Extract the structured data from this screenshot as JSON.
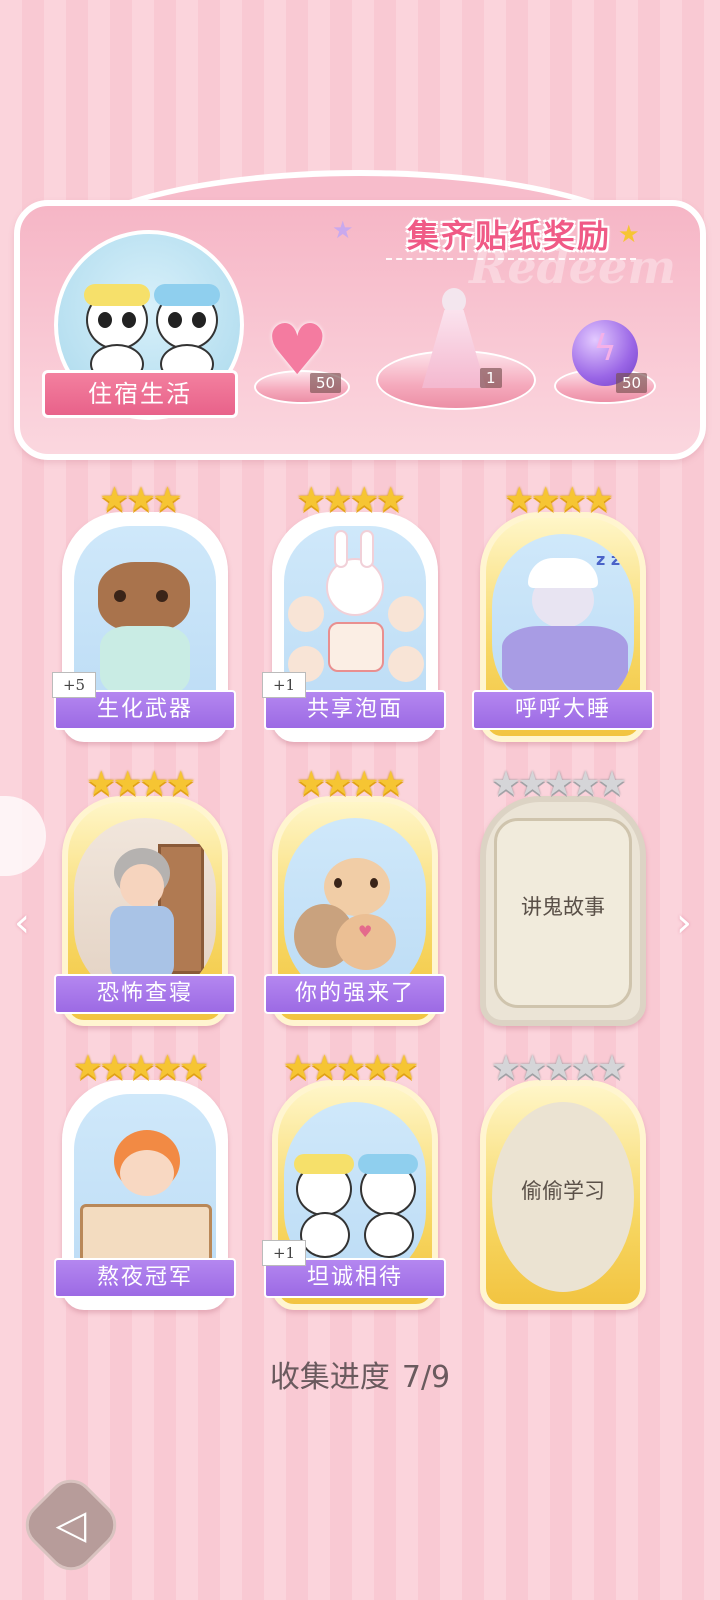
{
  "banner": {
    "title": "集齐贴纸奖励",
    "bg_word": "Redeem",
    "set_name": "住宿生活",
    "rewards": [
      {
        "name": "pink-heart-gem",
        "count": "50"
      },
      {
        "name": "princess-dress",
        "count": "1"
      },
      {
        "name": "purple-lightning-orb",
        "count": "50"
      }
    ]
  },
  "cards": [
    {
      "name": "生化武器",
      "stars": "★★★",
      "plus": "+5",
      "collected": true
    },
    {
      "name": "共享泡面",
      "stars": "★★★★",
      "plus": "+1",
      "collected": true
    },
    {
      "name": "呼呼大睡",
      "stars": "★★★★",
      "collected": true
    },
    {
      "name": "恐怖查寝",
      "stars": "★★★★",
      "collected": true
    },
    {
      "name": "你的强来了",
      "stars": "★★★★",
      "collected": true
    },
    {
      "name": "讲鬼故事",
      "stars": "★★★★★",
      "collected": false
    },
    {
      "name": "熬夜冠军",
      "stars": "★★★★★",
      "collected": true
    },
    {
      "name": "坦诚相待",
      "stars": "★★★★★",
      "plus": "+1",
      "collected": true
    },
    {
      "name": "偷偷学习",
      "stars": "★★★★★",
      "collected": false
    }
  ],
  "progress": {
    "label": "收集进度",
    "value": "7/9"
  },
  "nav": {
    "left_arrow": "‹",
    "right_arrow": "›",
    "back_icon": "◁"
  },
  "colors": {
    "accent_pink": "#f05a86",
    "name_purple": "#9c6ae4",
    "star_gold": "#f6c533"
  }
}
